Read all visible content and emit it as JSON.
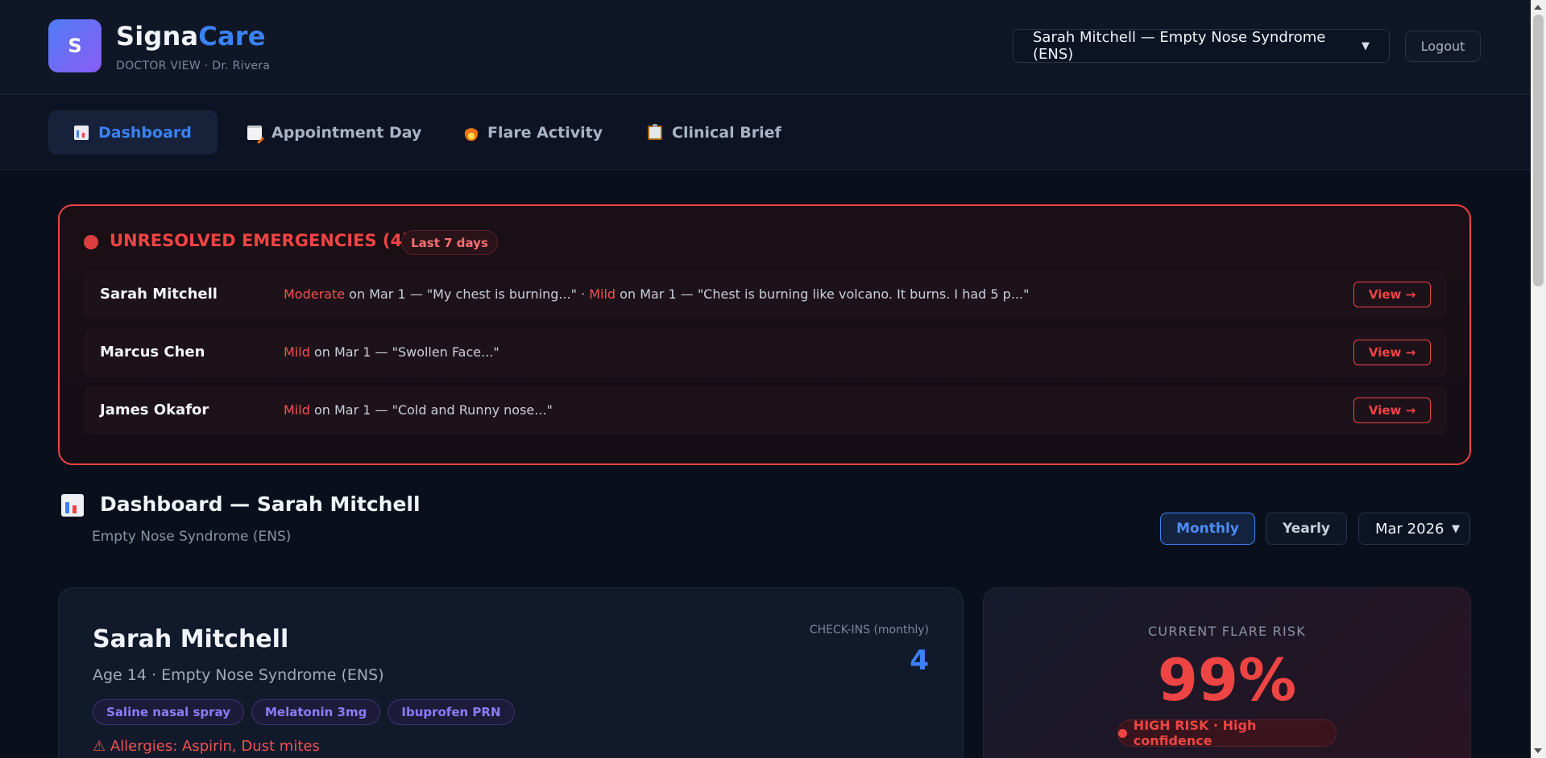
{
  "header": {
    "logo_letter": "S",
    "brand_part1": "Signa",
    "brand_part2": "Care",
    "subtitle": "DOCTOR VIEW · Dr. Rivera",
    "patient_select_value": "Sarah Mitchell — Empty Nose Syndrome (ENS)",
    "logout_label": "Logout"
  },
  "tabs": [
    {
      "label": "Dashboard",
      "icon": "bar-chart-icon",
      "active": true
    },
    {
      "label": "Appointment Day",
      "icon": "memo-icon",
      "active": false
    },
    {
      "label": "Flare Activity",
      "icon": "fire-icon",
      "active": false
    },
    {
      "label": "Clinical Brief",
      "icon": "clipboard-icon",
      "active": false
    }
  ],
  "emergencies": {
    "title": "UNRESOLVED EMERGENCIES (4)",
    "badge": "Last 7 days",
    "rows": [
      {
        "name": "Sarah Mitchell",
        "sev1": "Moderate",
        "text1": " on Mar 1 — \"My chest is burning...\" · ",
        "sev2": "Mild",
        "text2": " on Mar 1 — \"Chest is burning like volcano. It burns. I had 5 p...\"",
        "view_label": "View →"
      },
      {
        "name": "Marcus Chen",
        "sev1": "Mild",
        "text1": " on Mar 1 — \"Swollen Face...\"",
        "view_label": "View →"
      },
      {
        "name": "James Okafor",
        "sev1": "Mild",
        "text1": " on Mar 1 — \"Cold and Runny nose...\"",
        "view_label": "View →"
      }
    ]
  },
  "dashboard": {
    "title": "Dashboard — Sarah Mitchell",
    "subtitle": "Empty Nose Syndrome (ENS)",
    "toggle_monthly": "Monthly",
    "toggle_yearly": "Yearly",
    "period_value": "Mar 2026",
    "active_toggle": "Monthly"
  },
  "patient_card": {
    "name": "Sarah Mitchell",
    "info": "Age 14 · Empty Nose Syndrome (ENS)",
    "medications": [
      "Saline nasal spray",
      "Melatonin 3mg",
      "Ibuprofen PRN"
    ],
    "allergies": "⚠ Allergies: Aspirin, Dust mites",
    "checkins_label": "CHECK-INS (monthly)",
    "checkins_value": "4"
  },
  "risk_card": {
    "label": "CURRENT FLARE RISK",
    "value": "99%",
    "badge": "HIGH RISK · High confidence"
  },
  "colors": {
    "accent": "#3b82f6",
    "danger": "#ef4444",
    "medication_chip": "#8b7cf6",
    "background": "#0a0f1c"
  }
}
